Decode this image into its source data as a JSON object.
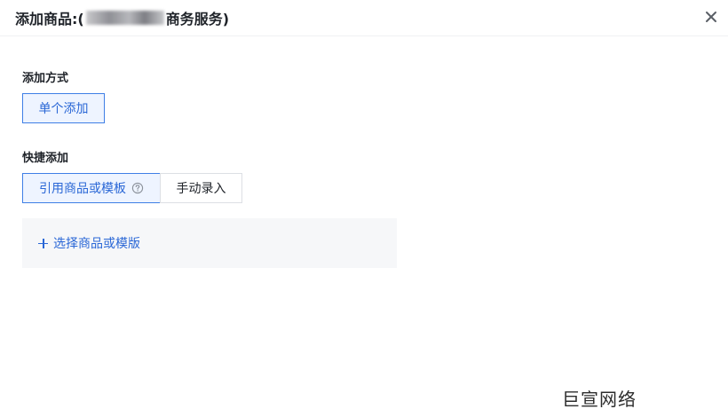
{
  "dialog": {
    "title_prefix": "添加商品:(",
    "title_suffix": "商务服务)",
    "close_icon": "close-icon"
  },
  "add_method": {
    "label": "添加方式",
    "option_single": "单个添加"
  },
  "quick_add": {
    "label": "快捷添加",
    "tab_reference": "引用商品或模板",
    "tab_manual": "手动录入",
    "help_icon": "question-circle-icon",
    "select_link": "选择商品或模版"
  },
  "watermark": {
    "text": "巨宣网络"
  },
  "colors": {
    "accent": "#2a67d6",
    "accent_border": "#3f7fe6",
    "active_bg": "#eef4ff",
    "panel_bg": "#f6f7f9"
  }
}
